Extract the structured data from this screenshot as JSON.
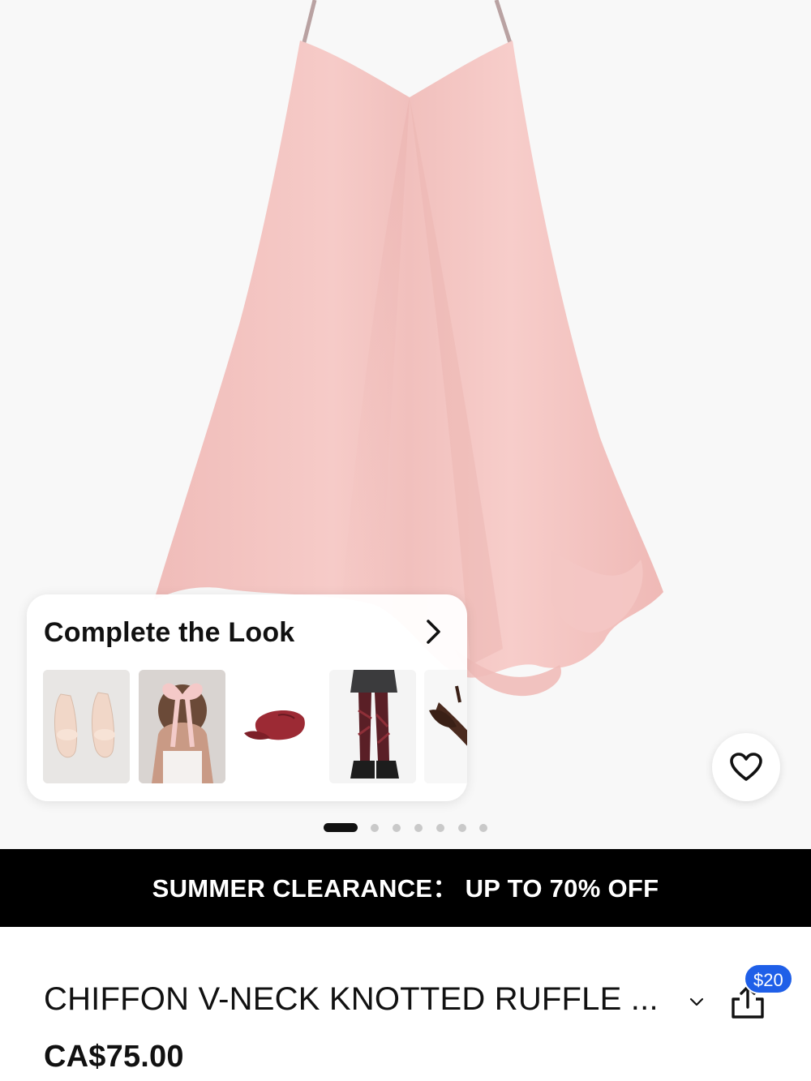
{
  "hero": {
    "image_icon": "pink-chiffon-dress-image",
    "active_slide": 1,
    "slide_count": 7
  },
  "complete_look": {
    "title": "Complete the Look",
    "items": [
      {
        "icon": "heeled-sandals-image"
      },
      {
        "icon": "hair-bow-image"
      },
      {
        "icon": "red-cap-image"
      },
      {
        "icon": "plaid-tights-outfit-image"
      },
      {
        "icon": "brown-slingback-heels-image"
      }
    ]
  },
  "promo": {
    "text": "SUMMER CLEARANCE： UP TO 70% OFF"
  },
  "product": {
    "title": "CHIFFON V-NECK KNOTTED RUFFLE ...",
    "price": "CA$75.00",
    "share_badge": "$20"
  },
  "colors": {
    "dress": "#f3c3c0",
    "promo_bg": "#000000",
    "badge": "#1f5fe8"
  }
}
